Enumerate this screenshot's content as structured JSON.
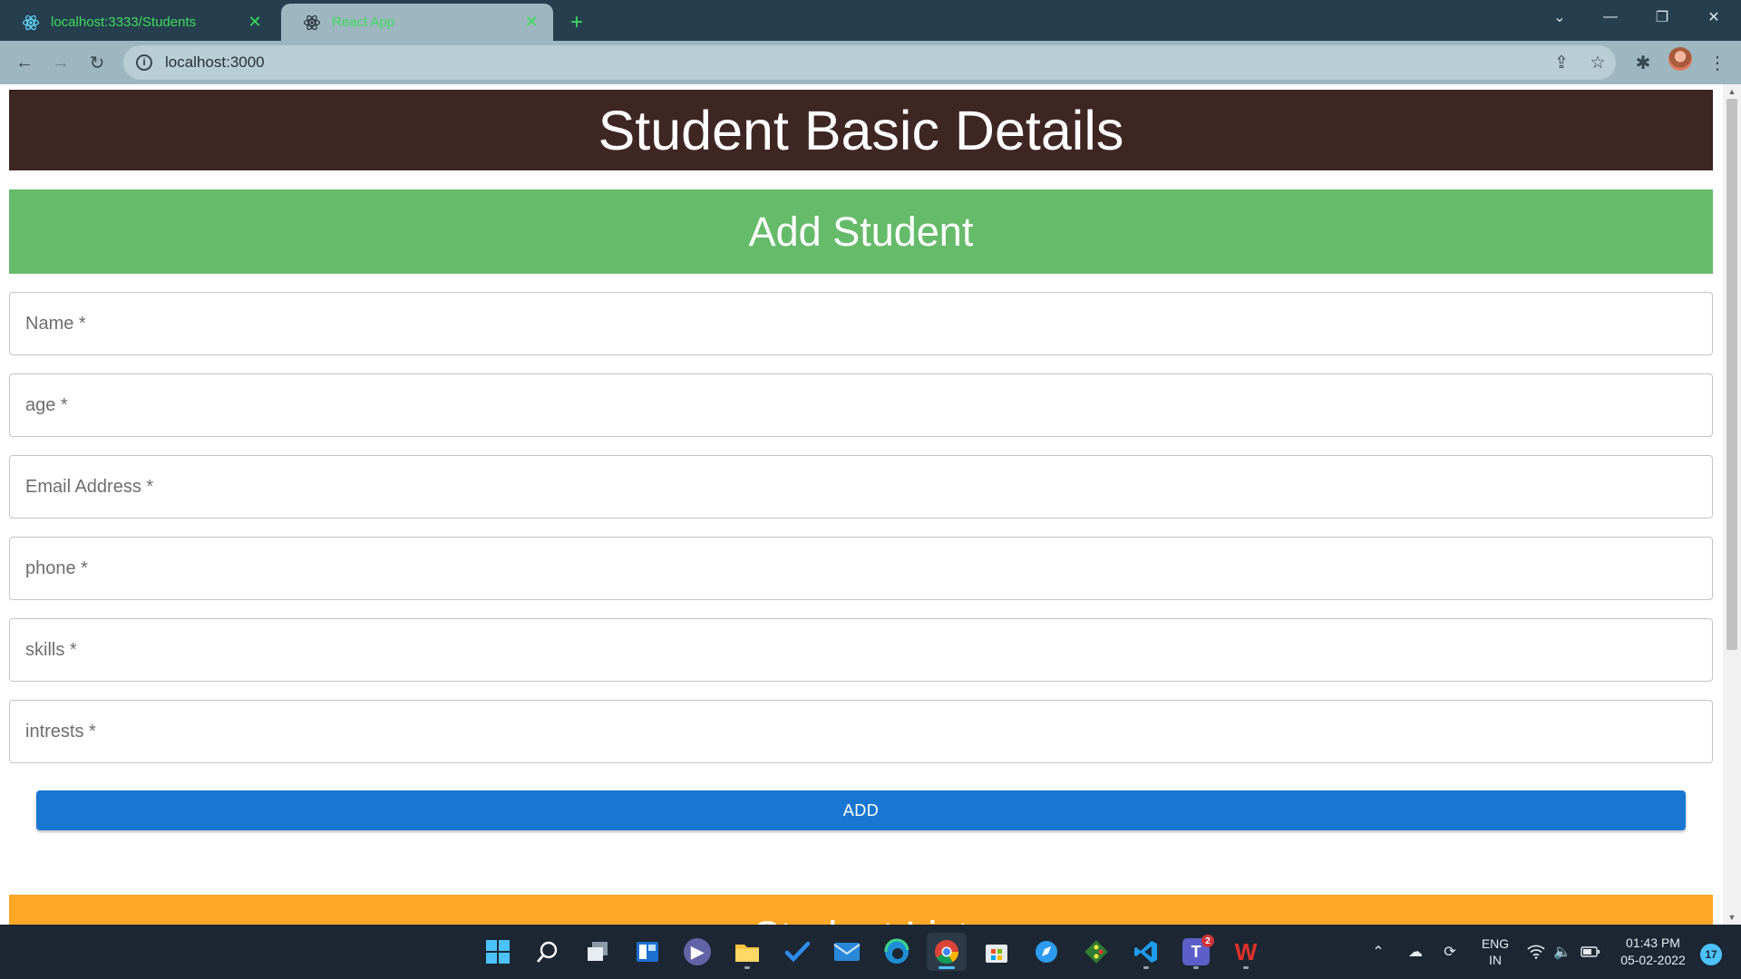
{
  "browser": {
    "tabs": [
      {
        "title": "localhost:3333/Students",
        "active": false,
        "favicon": "react-icon"
      },
      {
        "title": "React App",
        "active": true,
        "favicon": "react-icon"
      }
    ],
    "new_tab_label": "+",
    "url": "localhost:3000"
  },
  "page": {
    "header_title": "Student Basic Details",
    "form_title": "Add Student",
    "fields": [
      {
        "placeholder": "Name *"
      },
      {
        "placeholder": "age *"
      },
      {
        "placeholder": "Email Address *"
      },
      {
        "placeholder": "phone *"
      },
      {
        "placeholder": "skills *"
      },
      {
        "placeholder": "intrests *"
      }
    ],
    "add_button_label": "ADD",
    "list_title": "Student List"
  },
  "colors": {
    "header_bg": "#3e2623",
    "form_title_bg": "#66bb6a",
    "add_button_bg": "#1976d2",
    "list_title_bg": "#ffa726"
  },
  "taskbar": {
    "apps": [
      "windows-start-icon",
      "search-icon",
      "task-view-icon",
      "widgets-icon",
      "teams-chat-icon",
      "file-explorer-icon",
      "todo-icon",
      "mail-icon",
      "edge-icon",
      "chrome-icon",
      "microsoft-store-icon",
      "safari-icon",
      "git-icon",
      "vscode-icon",
      "teams-icon",
      "wps-office-icon"
    ],
    "teams_badge": "2",
    "language_line1": "ENG",
    "language_line2": "IN",
    "time": "01:43 PM",
    "date": "05-02-2022",
    "notification_count": "17"
  }
}
